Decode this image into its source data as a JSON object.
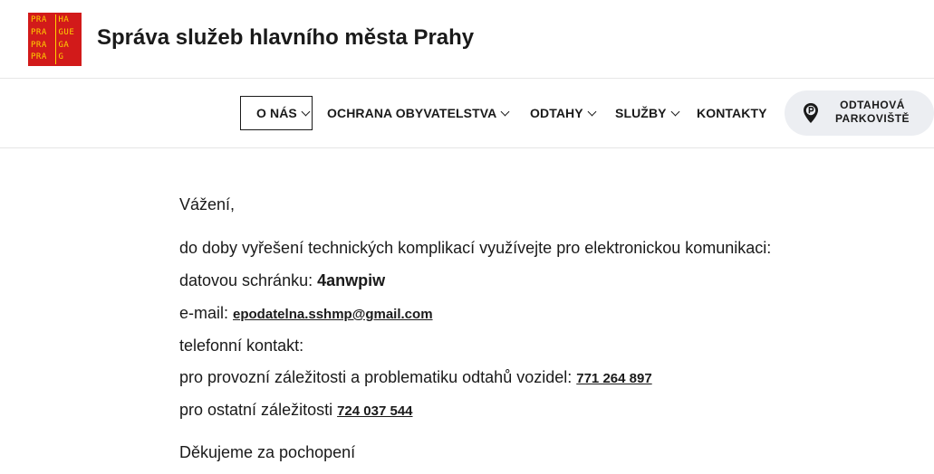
{
  "header": {
    "logo_lines": [
      [
        "PRA",
        "HA"
      ],
      [
        "PRA",
        "GUE"
      ],
      [
        "PRA",
        "GA"
      ],
      [
        "PRA",
        "G"
      ]
    ],
    "logo_colors": {
      "background": "#d21a1a",
      "text": "#ffd200"
    },
    "title": "Správa služeb hlavního města Prahy"
  },
  "nav": {
    "items": [
      {
        "label": "O NÁS",
        "has_dropdown": true,
        "focused": true
      },
      {
        "label": "OCHRANA OBYVATELSTVA",
        "has_dropdown": true
      },
      {
        "label": "ODTAHY",
        "has_dropdown": true
      },
      {
        "label": "SLUŽBY",
        "has_dropdown": true
      },
      {
        "label": "KONTAKTY",
        "has_dropdown": false
      }
    ],
    "parking_button": {
      "line1": "ODTAHOVÁ",
      "line2": "PARKOVIŠTĚ",
      "icon": "parking-pin-icon"
    }
  },
  "message": {
    "greeting": "Vážení,",
    "intro": "do doby vyřešení technických komplikací využívejte pro elektronickou komunikaci:",
    "databox_label": "datovou schránku: ",
    "databox_value": "4anwpiw",
    "email_label": "e-mail: ",
    "email_value": "epodatelna.sshmp@gmail.com",
    "phone_heading": "telefonní kontakt:",
    "phone1_label": "pro provozní záležitosti a problematiku odtahů vozidel: ",
    "phone1_value": "771 264 897",
    "phone2_label": "pro ostatní záležitosti ",
    "phone2_value": "724 037 544",
    "closing": "Děkujeme za pochopení"
  }
}
